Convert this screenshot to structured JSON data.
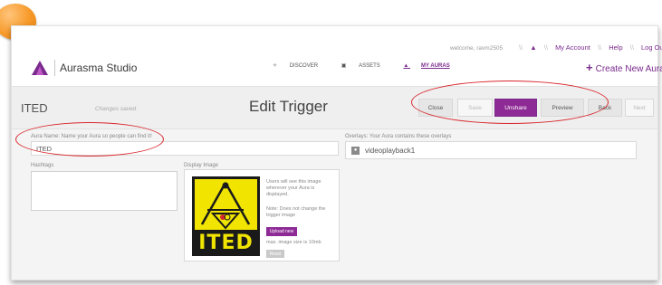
{
  "header": {
    "brand": "Aurasma Studio",
    "welcome": "welcome, ravm2505",
    "user_links": {
      "sep": "\\\\",
      "my_account": "My Account",
      "help": "Help",
      "log_out": "Log Out"
    },
    "nav": {
      "discover": "DISCOVER",
      "assets": "ASSETS",
      "my_auras": "MY AURAS"
    },
    "create_new": "Create New Aura"
  },
  "titlebar": {
    "aura_name": "ITED",
    "status": "Changes saved",
    "page_title": "Edit Trigger",
    "buttons": {
      "close": "Close",
      "save": "Save",
      "unshare": "Unshare",
      "preview": "Preview",
      "back": "Back",
      "next": "Next"
    }
  },
  "form": {
    "aura_name_label": "Aura Name: Name your Aura so people can find it!",
    "aura_name_value": "ITED",
    "hashtags_label": "Hashtags",
    "display_image_label": "Display Image",
    "display_info": "Users will see this image wherever your Aura is displayed.",
    "display_note": "Note: Does not change the trigger image",
    "upload_label": "Upload new",
    "max_size": "max. image size is 10mb",
    "reset_label": "Reset",
    "thumbnail_text": "ITED",
    "overlays_label": "Overlays: Your Aura contains these overlays",
    "overlays": [
      {
        "name": "videoplayback1"
      }
    ]
  },
  "colors": {
    "accent": "#8e2a95",
    "highlight": "#d8262c",
    "bubble": "#f79a2a"
  }
}
